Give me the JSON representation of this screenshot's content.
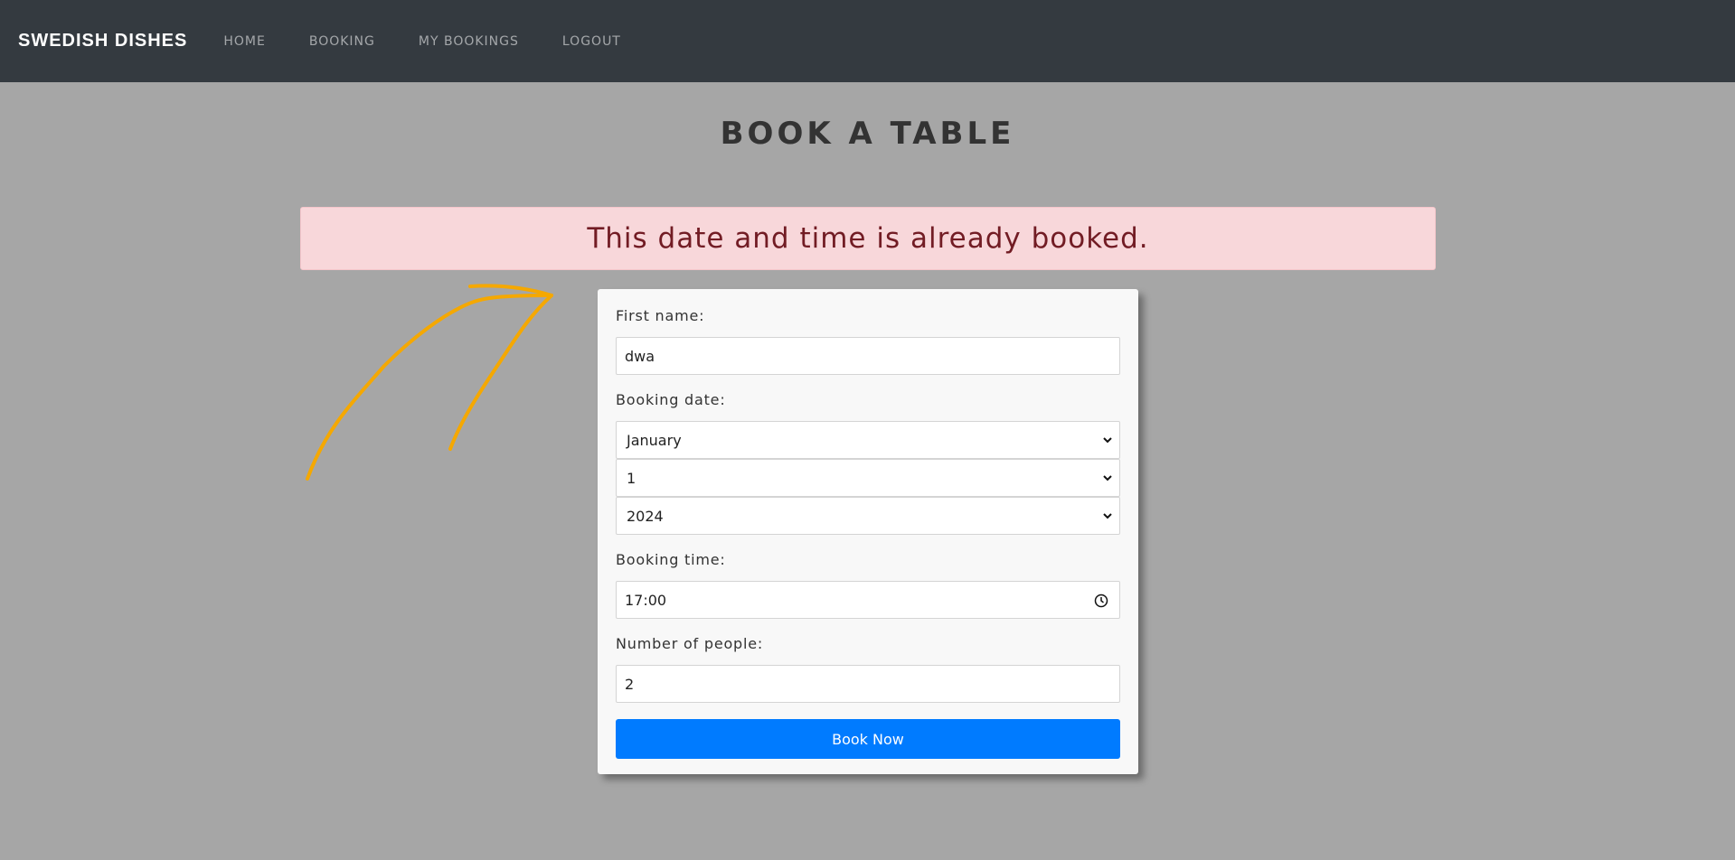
{
  "nav": {
    "brand": "SWEDISH DISHES",
    "links": [
      "HOME",
      "BOOKING",
      "MY BOOKINGS",
      "LOGOUT"
    ]
  },
  "page": {
    "title": "BOOK A TABLE"
  },
  "alert": {
    "message": "This date and time is already booked."
  },
  "form": {
    "first_name_label": "First name:",
    "first_name_value": "dwa",
    "date_label": "Booking date:",
    "month_value": "January",
    "day_value": "1",
    "year_value": "2024",
    "time_label": "Booking time:",
    "time_value": "17:00",
    "people_label": "Number of people:",
    "people_value": "2",
    "submit_label": "Book Now"
  },
  "colors": {
    "navbar": "#343a40",
    "background": "#a6a6a6",
    "alert_bg": "#f8d7da",
    "alert_text": "#721c24",
    "button": "#007bff",
    "arrow": "#f5a800"
  }
}
